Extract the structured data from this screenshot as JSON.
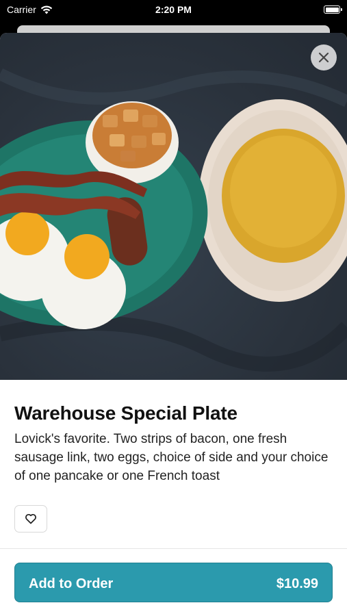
{
  "status_bar": {
    "carrier": "Carrier",
    "time": "2:20 PM"
  },
  "item": {
    "title": "Warehouse Special Plate",
    "description": "Lovick's favorite. Two strips of bacon, one fresh sausage link, two eggs, choice of side and your choice of one pancake or one French toast"
  },
  "order_button": {
    "label": "Add to Order",
    "price": "$10.99"
  },
  "colors": {
    "accent": "#2b9aad"
  },
  "icons": {
    "close": "close-icon",
    "favorite": "heart-outline-icon",
    "wifi": "wifi-icon",
    "battery": "battery-icon"
  }
}
